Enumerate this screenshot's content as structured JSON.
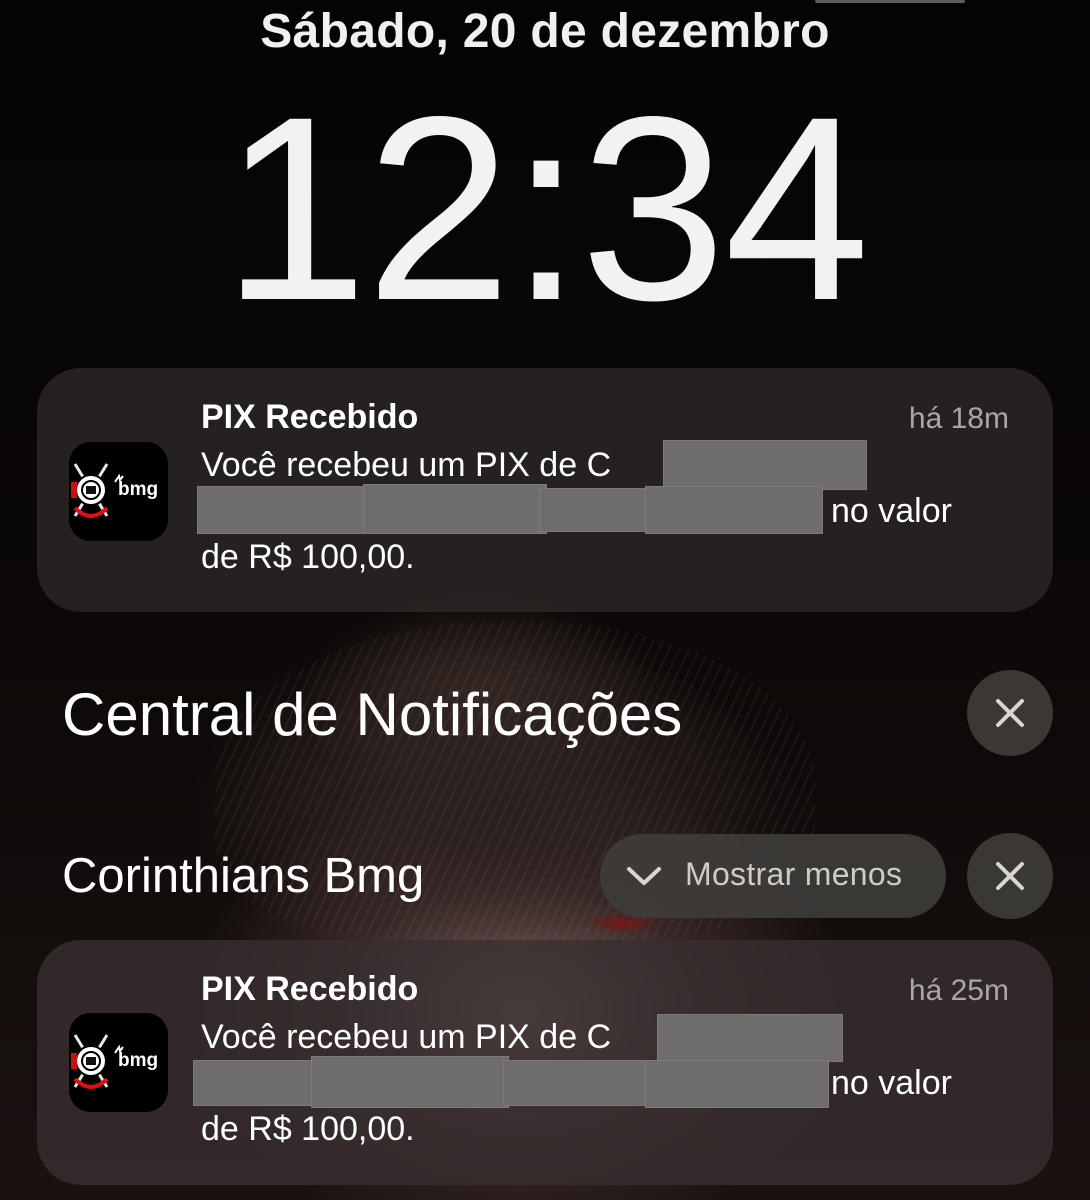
{
  "lock_screen": {
    "date": "Sábado, 20 de dezembro",
    "time": "12:34"
  },
  "top_notification": {
    "app_icon": "corinthians-bmg-app-icon",
    "icon_text": "bmg",
    "title": "PIX Recebido",
    "time_ago": "há 18m",
    "body_line1": "Você recebeu um PIX de C",
    "body_line2_suffix": "no valor",
    "body_line3": "de R$ 100,00."
  },
  "notification_center": {
    "title": "Central de Notificações",
    "clear_icon": "close-icon"
  },
  "group": {
    "app_name": "Corinthians Bmg",
    "show_less_label": "Mostrar menos",
    "show_less_icon": "chevron-down-icon",
    "clear_icon": "close-icon"
  },
  "group_notification": {
    "app_icon": "corinthians-bmg-app-icon",
    "icon_text": "bmg",
    "title": "PIX Recebido",
    "time_ago": "há 25m",
    "body_line1": "Você recebeu um PIX de C",
    "body_line2_suffix": "no valor",
    "body_line3": "de R$ 100,00."
  }
}
